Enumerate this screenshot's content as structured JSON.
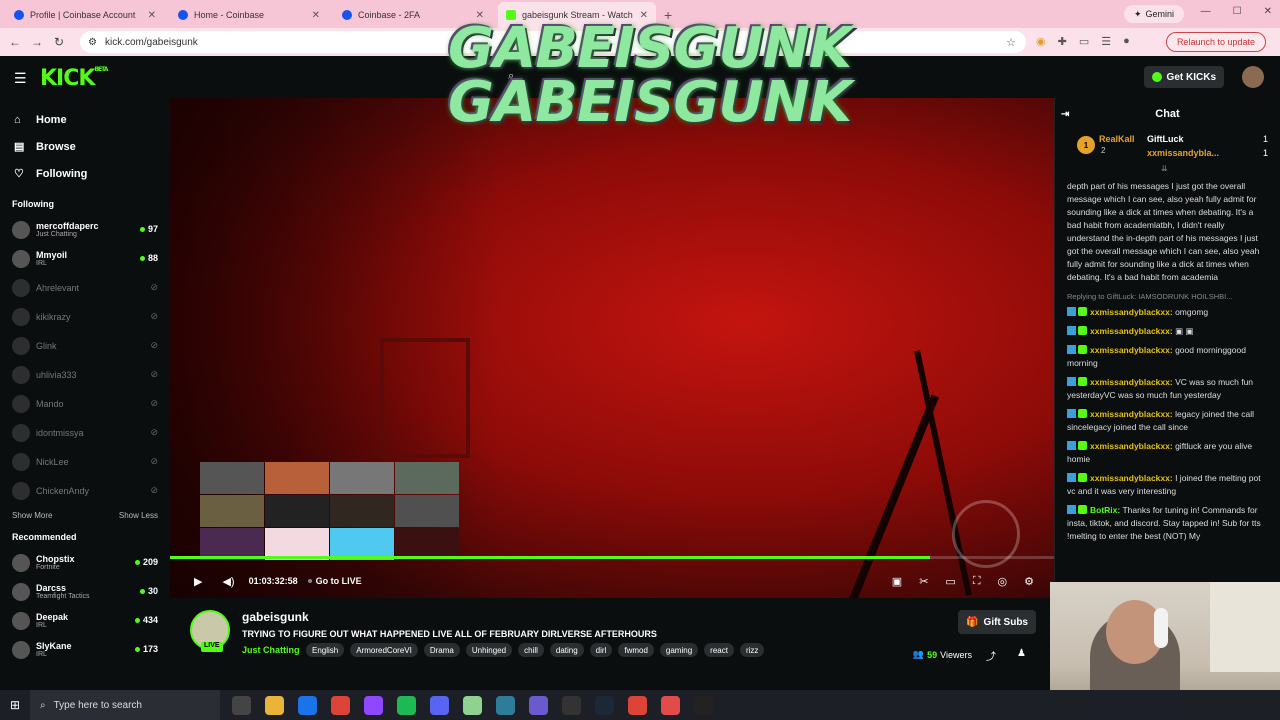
{
  "browser": {
    "tabs": [
      {
        "title": "Profile | Coinbase Account"
      },
      {
        "title": "Home - Coinbase"
      },
      {
        "title": "Coinbase - 2FA"
      },
      {
        "title": "gabeisgunk Stream - Watch Live"
      }
    ],
    "gemini_label": "Gemini",
    "url": "kick.com/gabeisgunk",
    "relaunch_label": "Relaunch to update"
  },
  "overlay": {
    "line1": "GABEISGUNK",
    "line2": "GABEISGUNK"
  },
  "header": {
    "get_kicks_label": "Get KICKs",
    "logo": "KICK",
    "logo_sup": "BETA"
  },
  "nav": [
    {
      "icon": "⌂",
      "label": "Home"
    },
    {
      "icon": "▤",
      "label": "Browse"
    },
    {
      "icon": "♡",
      "label": "Following"
    }
  ],
  "sidebar": {
    "following_title": "Following",
    "following": [
      {
        "name": "mercoffdaperc",
        "category": "Just Chatting",
        "viewers": "97",
        "live": true
      },
      {
        "name": "Mmyoil",
        "category": "IRL",
        "viewers": "88",
        "live": true
      },
      {
        "name": "Ahrelevant",
        "live": false
      },
      {
        "name": "kikikrazy",
        "live": false
      },
      {
        "name": "Glink",
        "live": false
      },
      {
        "name": "uhlivia333",
        "live": false
      },
      {
        "name": "Mando",
        "live": false
      },
      {
        "name": "idontmissya",
        "live": false
      },
      {
        "name": "NickLee",
        "live": false
      },
      {
        "name": "ChickenAndy",
        "live": false
      }
    ],
    "show_more": "Show More",
    "show_less": "Show Less",
    "recommended_title": "Recommended",
    "recommended": [
      {
        "name": "Chopstix",
        "category": "Fortnite",
        "viewers": "209"
      },
      {
        "name": "Darcss",
        "category": "Teamfight Tactics",
        "viewers": "30"
      },
      {
        "name": "Deepak",
        "category": "IRL",
        "viewers": "434"
      },
      {
        "name": "SlyKane",
        "category": "IRL",
        "viewers": "173"
      }
    ]
  },
  "player": {
    "time": "01:03:32:58",
    "go_live": "Go to LIVE",
    "progress": 0.86
  },
  "stream": {
    "streamer": "gabeisgunk",
    "live_badge": "LIVE",
    "title": "TRYING TO FIGURE OUT WHAT HAPPENED  LIVE ALL OF FEBRUARY DIRLVERSE AFTERHOURS",
    "category": "Just Chatting",
    "tags": [
      "English",
      "ArmoredCoreVI",
      "Drama",
      "Unhinged",
      "chill",
      "dating",
      "dirl",
      "fwmod",
      "gaming",
      "react",
      "rizz"
    ],
    "gift_subs": "Gift Subs",
    "viewers": "59",
    "viewers_label": "Viewers"
  },
  "chat": {
    "title": "Chat",
    "gifters": {
      "rank": "1",
      "top_name": "RealKall",
      "top_count": "2",
      "second": "GiftLuck",
      "second_count": "1",
      "third": "xxmissandybla...",
      "third_count": "1"
    },
    "messages": [
      {
        "user": "",
        "text": "depth part of his messages I just got the overall message which I can see, also yeah fully admit for sounding like a dick at times when debating. It's a bad habit from academlatbh, I didn't really understand the in-depth part of his messages I just got the overall message which I can see, also yeah fully admit for sounding like a dick at times when debating. It's a bad habit from academia"
      },
      {
        "reply": "Replying to GiftLuck: IAMSODRUNK HOILSHBI...",
        "user": "xxmissandyblackxx:",
        "text": "omgomg"
      },
      {
        "user": "xxmissandyblackxx:",
        "text": "▣ ▣"
      },
      {
        "user": "xxmissandyblackxx:",
        "text": "good morninggood morning"
      },
      {
        "user": "xxmissandyblackxx:",
        "text": "VC was so much fun yesterdayVC was so much fun yesterday"
      },
      {
        "user": "xxmissandyblackxx:",
        "text": "legacy joined the call sincelegacy joined the call since"
      },
      {
        "user": "xxmissandyblackxx:",
        "text": "giftluck are you alive homie"
      },
      {
        "user": "xxmissandyblackxx:",
        "text": "I joined the melting pot vc and it was very interesting"
      },
      {
        "user": "BotRix:",
        "bot": true,
        "text": "Thanks for tuning in! Commands for insta, tiktok, and discord. Stay tapped in! Sub for tts !melting to enter the best (NOT) My"
      }
    ]
  },
  "taskbar": {
    "search_placeholder": "Type here to search"
  }
}
